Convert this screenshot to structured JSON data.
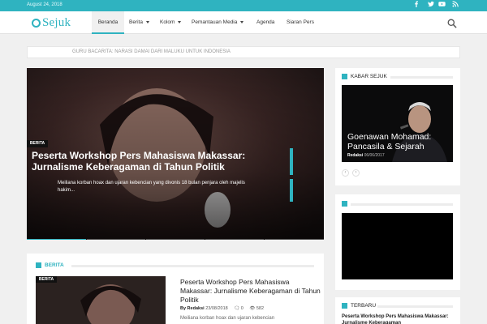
{
  "topbar": {
    "date": "August 24, 2018",
    "social_icons": [
      "facebook-icon",
      "twitter-icon",
      "youtube-icon",
      "rss-icon"
    ]
  },
  "brand": {
    "name": "Sejuk",
    "color": "#2fb3c0"
  },
  "nav": {
    "items": [
      {
        "label": "Beranda",
        "active": true
      },
      {
        "label": "Berita",
        "dropdown": true
      },
      {
        "label": "Kolom",
        "dropdown": true
      },
      {
        "label": "Pemantauan Media",
        "dropdown": true
      },
      {
        "label": "Agenda"
      },
      {
        "label": "Siaran Pers"
      }
    ],
    "search_icon": "search-icon"
  },
  "ticker": {
    "text": "GURU BACARITA: NARASI DAMAI DARI MALUKU UNTUK INDONESIA"
  },
  "hero": {
    "category": "BERITA",
    "title": "Peserta Workshop Pers Mahasiswa Makassar: Jurnalisme Keberagaman di Tahun Politik",
    "excerpt": "Meiliana korban hoax dan ujaran kebencian yang divonis 18 bulan penjara oleh majelis hakim..."
  },
  "kabar_sejuk": {
    "heading": "KABAR SEJUK",
    "title": "Goenawan Mohamad: Pancasila & Sejarah",
    "author": "Redaksi",
    "date": "06/06/2017",
    "prev_icon": "chevron-left-icon",
    "next_icon": "chevron-right-icon"
  },
  "berita_section": {
    "heading": "BERITA",
    "category": "BERITA",
    "title": "Peserta Workshop Pers Mahasiswa Makassar: Jurnalisme Keberagaman di Tahun Politik",
    "author": "By Redaksi",
    "date": "23/08/2018",
    "comments": "0",
    "views": "582",
    "excerpt": "Meiliana korban hoax dan ujaran kebencian"
  },
  "terbaru": {
    "heading": "TERBARU",
    "title": "Peserta Workshop Pers Mahasiswa Makassar: Jurnalisme Keberagaman"
  },
  "colors": {
    "accent": "#2fb3c0",
    "dark": "#111111"
  }
}
